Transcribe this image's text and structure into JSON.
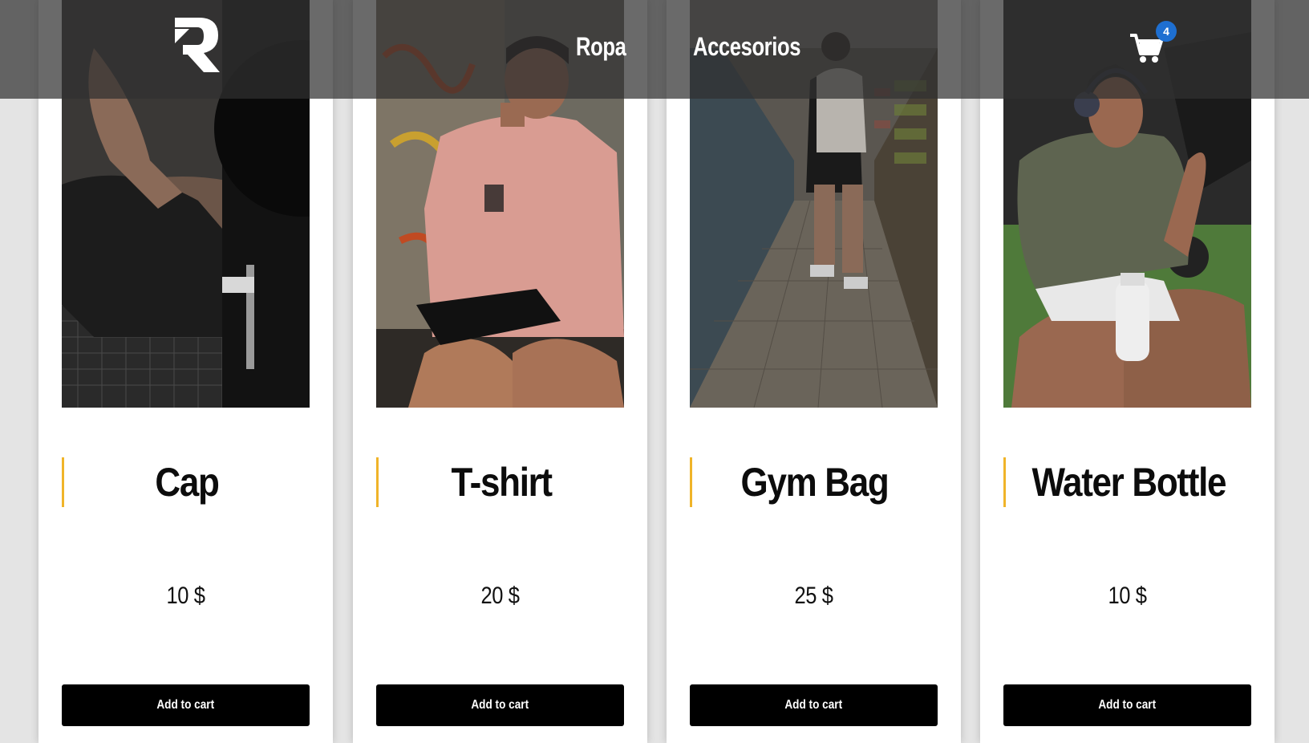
{
  "nav": {
    "links": [
      "Ropa",
      "Accesorios"
    ],
    "cart_count": "4"
  },
  "products": [
    {
      "name": "Cap",
      "price": "10 $",
      "button": "Add to cart"
    },
    {
      "name": "T-shirt",
      "price": "20 $",
      "button": "Add to cart"
    },
    {
      "name": "Gym Bag",
      "price": "25 $",
      "button": "Add to cart"
    },
    {
      "name": "Water Bottle",
      "price": "10 $",
      "button": "Add to cart"
    }
  ],
  "colors": {
    "accent": "#f0b429",
    "badge": "#1e6fd1",
    "button": "#000000"
  }
}
